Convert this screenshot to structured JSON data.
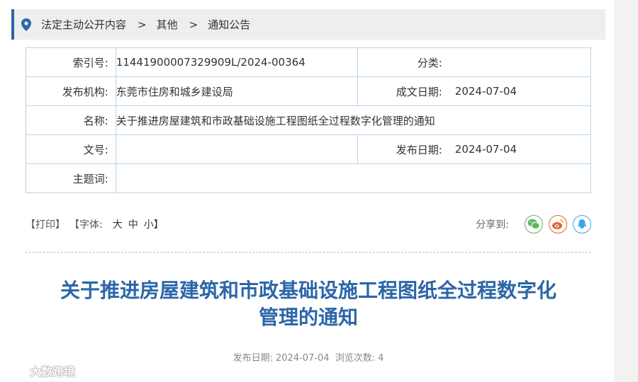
{
  "breadcrumb": {
    "items": [
      "法定主动公开内容",
      "其他",
      "通知公告"
    ],
    "separator": ">"
  },
  "meta": {
    "index_label": "索引号:",
    "index_value": "11441900007329909L/2024-00364",
    "category_label": "分类:",
    "category_value": "",
    "org_label": "发布机构:",
    "org_value": "东莞市住房和城乡建设局",
    "created_label": "成文日期:",
    "created_value": "2024-07-04",
    "name_label": "名称:",
    "name_value": "关于推进房屋建筑和市政基础设施工程图纸全过程数字化管理的通知",
    "docno_label": "文号:",
    "docno_value": "",
    "published_label": "发布日期:",
    "published_value": "2024-07-04",
    "keywords_label": "主题词:",
    "keywords_value": ""
  },
  "toolbar": {
    "print": "【打印】",
    "font_label": "【字体:",
    "font_large": "大",
    "font_medium": "中",
    "font_small": "小】",
    "share_label": "分享到:"
  },
  "share": {
    "wechat_icon": "wechat-icon",
    "weibo_icon": "weibo-icon",
    "qq_icon": "qq-icon",
    "wechat_color": "#5cb85c",
    "weibo_color": "#e8642a",
    "qq_color": "#3aa7e6"
  },
  "article": {
    "title_line1": "关于推进房屋建筑和市政基础设施工程图纸全过程数字化",
    "title_line2": "管理的通知",
    "publish_label": "发布日期:",
    "publish_date": "2024-07-04",
    "views_label": "浏览次数:",
    "views": "4"
  },
  "watermark": {
    "text": "大数跨境"
  },
  "colors": {
    "accent": "#2c66a8",
    "table_border": "#b9d3ea"
  }
}
